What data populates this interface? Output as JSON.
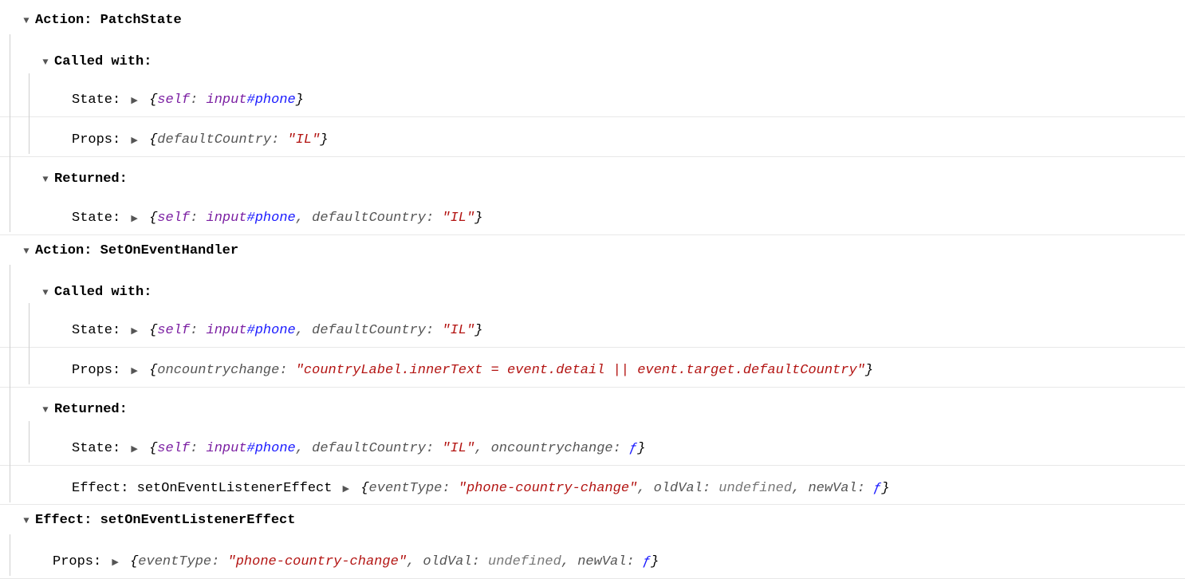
{
  "labels": {
    "action_prefix": "Action: ",
    "effect_prefix": "Effect: ",
    "called_with": "Called with:",
    "returned": "Returned:",
    "state": "State:",
    "props": "Props:",
    "effect": "Effect:"
  },
  "actions": [
    {
      "name": "PatchState",
      "called_with": {
        "state": {
          "self_key": "self",
          "self_elem": "input",
          "self_id": "#phone"
        },
        "props": {
          "k1": "defaultCountry",
          "v1": "\"IL\""
        }
      },
      "returned": {
        "state": {
          "self_key": "self",
          "self_elem": "input",
          "self_id": "#phone",
          "k1": "defaultCountry",
          "v1": "\"IL\""
        }
      }
    },
    {
      "name": "SetOnEventHandler",
      "called_with": {
        "state": {
          "self_key": "self",
          "self_elem": "input",
          "self_id": "#phone",
          "k1": "defaultCountry",
          "v1": "\"IL\""
        },
        "props": {
          "k1": "oncountrychange",
          "v1": "\"countryLabel.innerText = event.detail || event.target.defaultCountry\""
        }
      },
      "returned": {
        "state": {
          "self_key": "self",
          "self_elem": "input",
          "self_id": "#phone",
          "k1": "defaultCountry",
          "v1": "\"IL\"",
          "k2": "oncountrychange",
          "v2_fn": "ƒ"
        },
        "effect": {
          "name": "setOnEventListenerEffect",
          "k1": "eventType",
          "v1": "\"phone-country-change\"",
          "k2": "oldVal",
          "v2_undef": "undefined",
          "k3": "newVal",
          "v3_fn": "ƒ"
        }
      }
    }
  ],
  "top_effect": {
    "name": "setOnEventListenerEffect",
    "props": {
      "k1": "eventType",
      "v1": "\"phone-country-change\"",
      "k2": "oldVal",
      "v2_undef": "undefined",
      "k3": "newVal",
      "v3_fn": "ƒ"
    }
  }
}
